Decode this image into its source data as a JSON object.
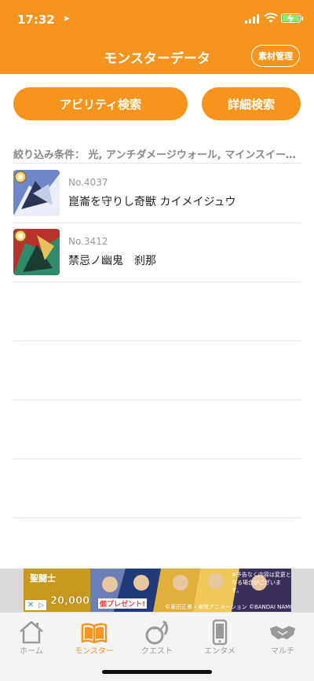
{
  "status": {
    "time": "17:32"
  },
  "header": {
    "title": "モンスターデータ",
    "materials_button": "素材管理"
  },
  "search": {
    "ability_button": "アビリティ検索",
    "detail_button": "詳細検索"
  },
  "filter": {
    "text": "絞り込み条件： 光, アンチダメージウォール, マインスイーパー"
  },
  "monsters": [
    {
      "number": "No.4037",
      "name": "崑崙を守りし奇獣 カイメイジュウ"
    },
    {
      "number": "No.3412",
      "name": "禁忌ノ幽鬼　刹那"
    }
  ],
  "ad": {
    "count": "20,000",
    "present": "個プレゼント!",
    "notice": "※予告なく内容は変更となる場合がございます。",
    "credit": "©車田正美・東映アニメーション ©BANDAI NAMCO Entertainment Inc."
  },
  "tabs": [
    {
      "label": "ホーム",
      "icon": "home-icon"
    },
    {
      "label": "モンスター",
      "icon": "book-icon",
      "active": true
    },
    {
      "label": "クエスト",
      "icon": "quest-icon"
    },
    {
      "label": "エンタメ",
      "icon": "phone-icon"
    },
    {
      "label": "マルチ",
      "icon": "handshake-icon"
    }
  ],
  "colors": {
    "accent": "#f7941d",
    "tab_inactive": "#9a9a9a",
    "divider": "#e4e4e4"
  }
}
